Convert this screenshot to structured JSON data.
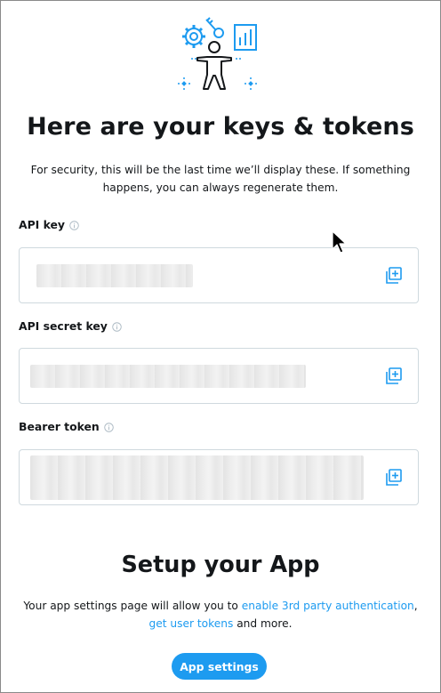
{
  "header": {
    "title": "Here are your keys & tokens",
    "intro": "For security, this will be the last time we’ll display these. If something happens, you can always regenerate them."
  },
  "credentials": [
    {
      "label": "API key",
      "info_icon": "info-icon",
      "copy_icon": "copy-icon",
      "value_state": "blurred"
    },
    {
      "label": "API secret key",
      "info_icon": "info-icon",
      "copy_icon": "copy-icon",
      "value_state": "blurred"
    },
    {
      "label": "Bearer token",
      "info_icon": "info-icon",
      "copy_icon": "copy-icon",
      "value_state": "blurred"
    }
  ],
  "setup": {
    "title": "Setup your App",
    "text_before": "Your app settings page will allow you to ",
    "link1": "enable 3rd party authentication",
    "separator": ", ",
    "link2": "get user tokens",
    "text_after": " and more.",
    "button_label": "App settings"
  },
  "colors": {
    "accent": "#1d9bf0",
    "text": "#14171a",
    "border": "#cfd9de"
  }
}
